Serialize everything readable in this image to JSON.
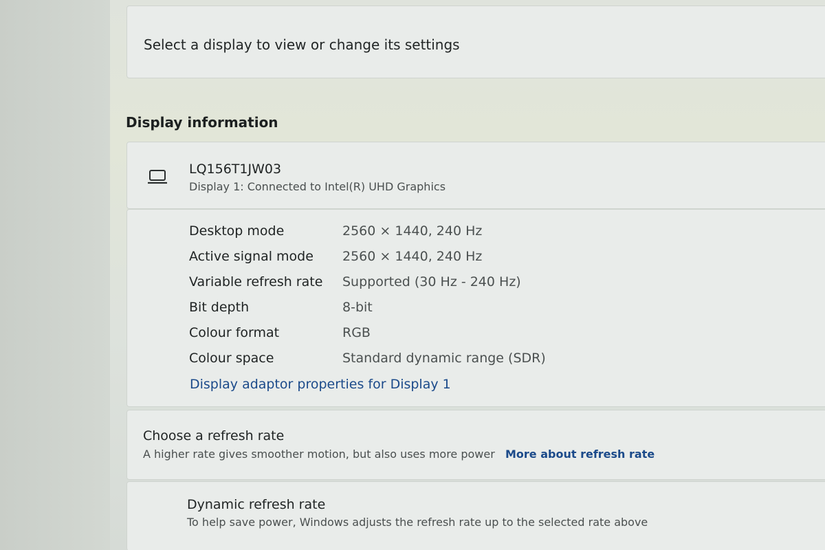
{
  "select_display": {
    "text": "Select a display to view or change its settings"
  },
  "display_information": {
    "section_title": "Display information",
    "display_name": "LQ156T1JW03",
    "display_subtitle": "Display 1: Connected to Intel(R) UHD Graphics",
    "icon": "laptop-icon",
    "rows": [
      {
        "label": "Desktop mode",
        "value": "2560 × 1440, 240 Hz"
      },
      {
        "label": "Active signal mode",
        "value": "2560 × 1440, 240 Hz"
      },
      {
        "label": "Variable refresh rate",
        "value": "Supported (30 Hz - 240 Hz)"
      },
      {
        "label": "Bit depth",
        "value": "8-bit"
      },
      {
        "label": "Colour format",
        "value": "RGB"
      },
      {
        "label": "Colour space",
        "value": "Standard dynamic range (SDR)"
      }
    ],
    "adaptor_link": "Display adaptor properties for Display 1"
  },
  "refresh_rate": {
    "title": "Choose a refresh rate",
    "subtitle": "A higher rate gives smoother motion, but also uses more power",
    "link": "More about refresh rate"
  },
  "dynamic_refresh": {
    "title": "Dynamic refresh rate",
    "subtitle": "To help save power, Windows adjusts the refresh rate up to the selected rate above"
  },
  "colors": {
    "link": "#1b4a8a",
    "card": "#e9ecea",
    "background": "#d9ddd6"
  }
}
